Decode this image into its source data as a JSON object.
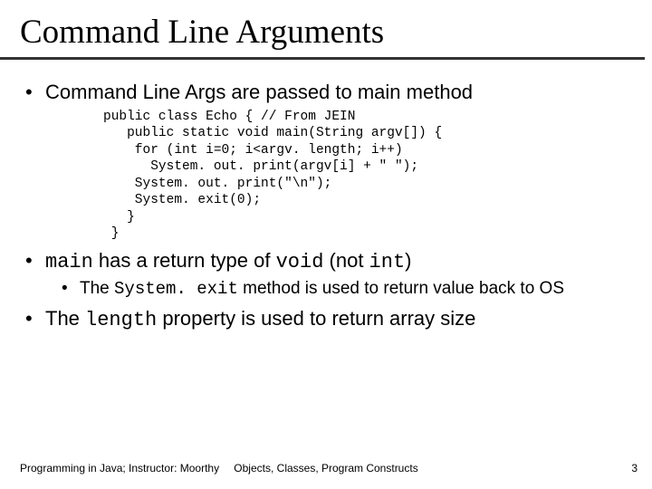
{
  "title": "Command Line Arguments",
  "bullets": {
    "b1": "Command Line Args are passed to main method",
    "b2": {
      "pre": "",
      "m1": "main",
      "mid1": " has a return type of ",
      "m2": "void",
      "mid2": " (not ",
      "m3": "int",
      "post": ")"
    },
    "b2_sub": {
      "pre": "The ",
      "m1": "System. exit",
      "post": " method is used to return value back to OS"
    },
    "b3": {
      "pre": "The ",
      "m1": "length",
      "post": "  property is used to return array size"
    }
  },
  "code": "public class Echo { // From JEIN\n   public static void main(String argv[]) {\n    for (int i=0; i<argv. length; i++)\n      System. out. print(argv[i] + \" \");\n    System. out. print(\"\\n\");\n    System. exit(0);\n   }\n }",
  "footer": {
    "left": "Programming in Java; Instructor: Moorthy",
    "center": "Objects, Classes, Program Constructs",
    "right": "3"
  }
}
